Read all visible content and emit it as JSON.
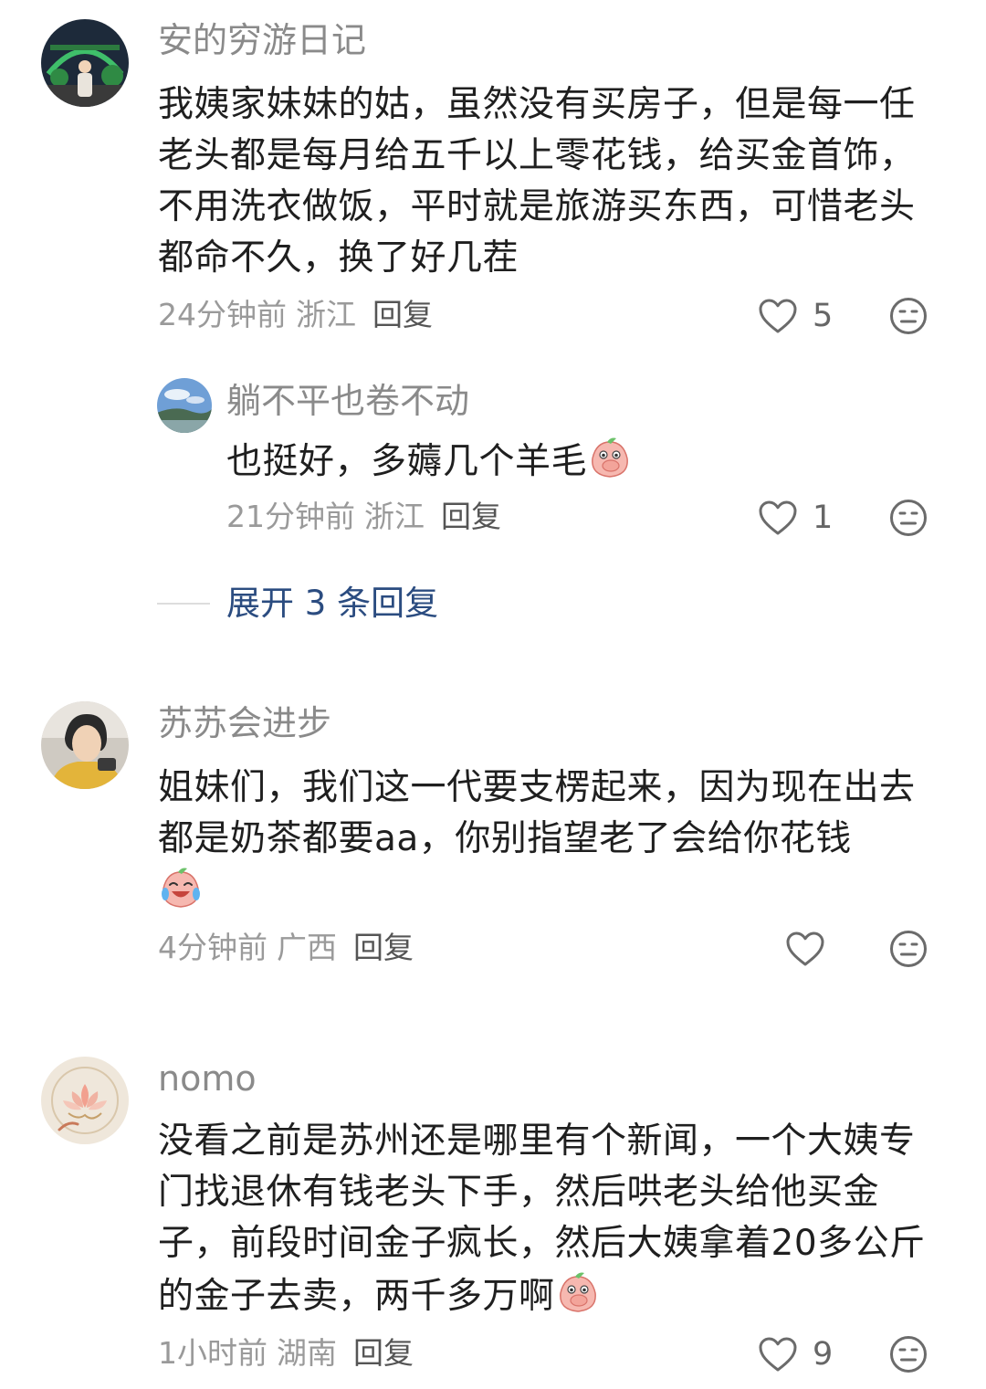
{
  "colors": {
    "username": "#8a8a8a",
    "content": "#1f1f1f",
    "meta": "#9a9a9a",
    "expand_link": "#2b4c80"
  },
  "comments": [
    {
      "username": "安的穷游日记",
      "content": "我姨家妹妹的姑，虽然没有买房子，但是每一任老头都是每月给五千以上零花钱，给买金首饰，不用洗衣做饭，平时就是旅游买东西，可惜老头都命不久，换了好几茬",
      "time": "24分钟前",
      "location": "浙江",
      "reply_label": "回复",
      "likes": "5",
      "avatar_icon": "avatar-night-scene",
      "replies": [
        {
          "username": "躺不平也卷不动",
          "content": "也挺好，多薅几个羊毛",
          "emoji": "covering-mouth-peach-emoji",
          "time": "21分钟前",
          "location": "浙江",
          "reply_label": "回复",
          "likes": "1",
          "avatar_icon": "avatar-landscape"
        }
      ],
      "expand_label": "展开 3 条回复"
    },
    {
      "username": "苏苏会进步",
      "content": "姐妹们，我们这一代要支楞起来，因为现在出去都是奶茶都要aa，你别指望老了会给你花钱",
      "emoji": "laughing-tears-peach-emoji",
      "time": "4分钟前",
      "location": "广西",
      "reply_label": "回复",
      "likes": "",
      "avatar_icon": "avatar-person"
    },
    {
      "username": "nomo",
      "content": "没看之前是苏州还是哪里有个新闻，一个大姨专门找退休有钱老头下手，然后哄老头给他买金子，前段时间金子疯长，然后大姨拿着20多公斤的金子去卖，两千多万啊",
      "emoji": "covering-mouth-peach-emoji",
      "time": "1小时前",
      "location": "湖南",
      "reply_label": "回复",
      "likes": "9",
      "avatar_icon": "avatar-lotus"
    }
  ]
}
